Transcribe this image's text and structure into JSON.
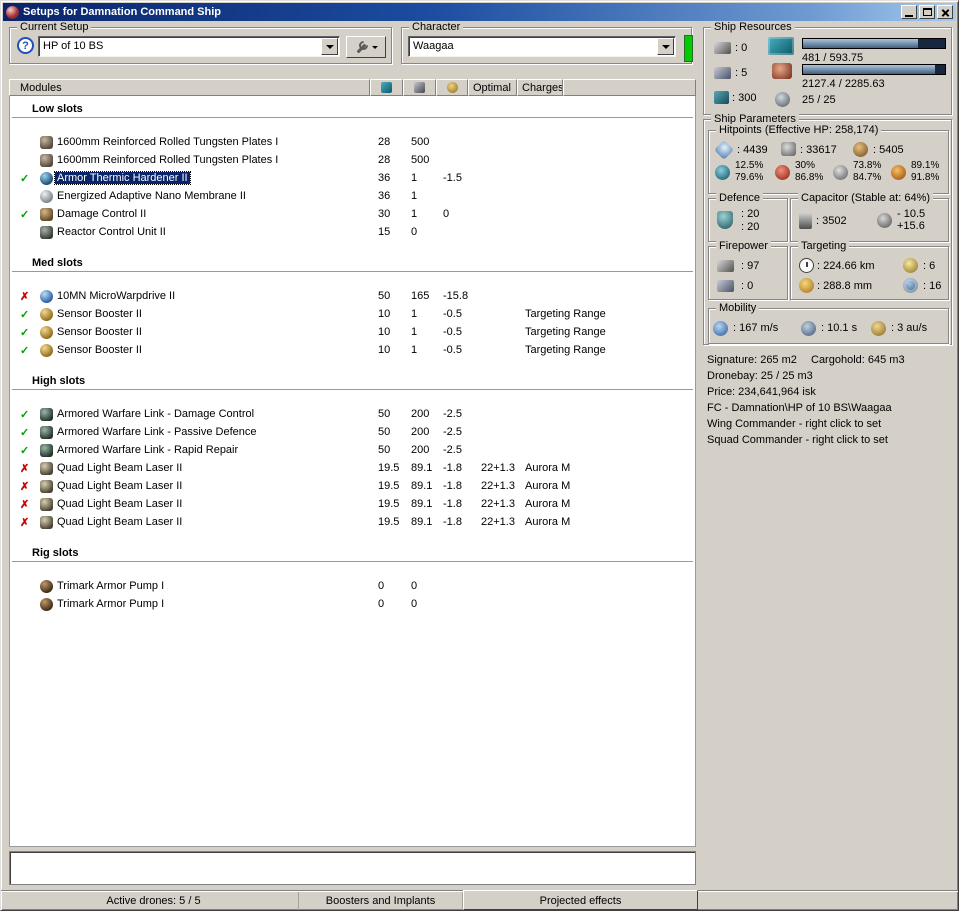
{
  "window": {
    "title": "Setups for Damnation Command Ship"
  },
  "colors": {
    "titlebar_left": "#0a246a",
    "titlebar_right": "#a6caf0",
    "selection": "#0a246a",
    "status_ok": "#00a000",
    "status_error": "#cc0000",
    "character_indicator": "#00cc00"
  },
  "status_glyphs": {
    "ok": "✓",
    "error": "✗"
  },
  "setup_bar": {
    "current_setup_label": "Current Setup",
    "help_glyph": "?",
    "setup_value": "HP of 10 BS",
    "character_label": "Character",
    "character_value": "Waagaa"
  },
  "modules_table": {
    "columns": {
      "modules": "Modules",
      "optimal": "Optimal",
      "charges": "Charges"
    },
    "sections": [
      {
        "title": "Low slots",
        "rows": [
          {
            "status": "none",
            "icon": "armor-plate",
            "name": "1600mm Reinforced Rolled Tungsten Plates I",
            "cpu": "28",
            "pg": "500",
            "cap": "",
            "optimal": "",
            "charges": "",
            "selected": false
          },
          {
            "status": "none",
            "icon": "armor-plate",
            "name": "1600mm Reinforced Rolled Tungsten Plates I",
            "cpu": "28",
            "pg": "500",
            "cap": "",
            "optimal": "",
            "charges": "",
            "selected": false
          },
          {
            "status": "ok",
            "icon": "armor-hardener",
            "name": "Armor Thermic Hardener II",
            "cpu": "36",
            "pg": "1",
            "cap": "-1.5",
            "optimal": "",
            "charges": "",
            "selected": true
          },
          {
            "status": "none",
            "icon": "nano-membrane",
            "name": "Energized Adaptive Nano Membrane II",
            "cpu": "36",
            "pg": "1",
            "cap": "",
            "optimal": "",
            "charges": "",
            "selected": false
          },
          {
            "status": "ok",
            "icon": "damage-control",
            "name": "Damage Control II",
            "cpu": "30",
            "pg": "1",
            "cap": "0",
            "optimal": "",
            "charges": "",
            "selected": false
          },
          {
            "status": "none",
            "icon": "reactor-control",
            "name": "Reactor Control Unit II",
            "cpu": "15",
            "pg": "0",
            "cap": "",
            "optimal": "",
            "charges": "",
            "selected": false
          }
        ]
      },
      {
        "title": "Med slots",
        "rows": [
          {
            "status": "error",
            "icon": "mwd",
            "name": "10MN MicroWarpdrive II",
            "cpu": "50",
            "pg": "165",
            "cap": "-15.8",
            "optimal": "",
            "charges": "",
            "selected": false
          },
          {
            "status": "ok",
            "icon": "sensor-booster",
            "name": "Sensor Booster II",
            "cpu": "10",
            "pg": "1",
            "cap": "-0.5",
            "optimal": "",
            "charges": "Targeting Range",
            "selected": false
          },
          {
            "status": "ok",
            "icon": "sensor-booster",
            "name": "Sensor Booster II",
            "cpu": "10",
            "pg": "1",
            "cap": "-0.5",
            "optimal": "",
            "charges": "Targeting Range",
            "selected": false
          },
          {
            "status": "ok",
            "icon": "sensor-booster",
            "name": "Sensor Booster II",
            "cpu": "10",
            "pg": "1",
            "cap": "-0.5",
            "optimal": "",
            "charges": "Targeting Range",
            "selected": false
          }
        ]
      },
      {
        "title": "High slots",
        "rows": [
          {
            "status": "ok",
            "icon": "warfare-link",
            "name": "Armored Warfare Link - Damage Control",
            "cpu": "50",
            "pg": "200",
            "cap": "-2.5",
            "optimal": "",
            "charges": "",
            "selected": false
          },
          {
            "status": "ok",
            "icon": "warfare-link",
            "name": "Armored Warfare Link - Passive Defence",
            "cpu": "50",
            "pg": "200",
            "cap": "-2.5",
            "optimal": "",
            "charges": "",
            "selected": false
          },
          {
            "status": "ok",
            "icon": "warfare-link",
            "name": "Armored Warfare Link - Rapid Repair",
            "cpu": "50",
            "pg": "200",
            "cap": "-2.5",
            "optimal": "",
            "charges": "",
            "selected": false
          },
          {
            "status": "error",
            "icon": "laser",
            "name": "Quad Light Beam Laser II",
            "cpu": "19.5",
            "pg": "89.1",
            "cap": "-1.8",
            "optimal": "22+1.3",
            "charges": "Aurora M",
            "selected": false
          },
          {
            "status": "error",
            "icon": "laser",
            "name": "Quad Light Beam Laser II",
            "cpu": "19.5",
            "pg": "89.1",
            "cap": "-1.8",
            "optimal": "22+1.3",
            "charges": "Aurora M",
            "selected": false
          },
          {
            "status": "error",
            "icon": "laser",
            "name": "Quad Light Beam Laser II",
            "cpu": "19.5",
            "pg": "89.1",
            "cap": "-1.8",
            "optimal": "22+1.3",
            "charges": "Aurora M",
            "selected": false
          },
          {
            "status": "error",
            "icon": "laser",
            "name": "Quad Light Beam Laser II",
            "cpu": "19.5",
            "pg": "89.1",
            "cap": "-1.8",
            "optimal": "22+1.3",
            "charges": "Aurora M",
            "selected": false
          }
        ]
      },
      {
        "title": "Rig slots",
        "rows": [
          {
            "status": "none",
            "icon": "rig",
            "name": "Trimark Armor Pump I",
            "cpu": "0",
            "pg": "0",
            "cap": "",
            "optimal": "",
            "charges": "",
            "selected": false
          },
          {
            "status": "none",
            "icon": "rig",
            "name": "Trimark Armor Pump I",
            "cpu": "0",
            "pg": "0",
            "cap": "",
            "optimal": "",
            "charges": "",
            "selected": false
          }
        ]
      }
    ]
  },
  "ship_resources": {
    "title": "Ship Resources",
    "turrets": ": 0",
    "launchers": ": 5",
    "calibration": ": 300",
    "cpu_text": "481 / 593.75",
    "cpu_pct": 81,
    "powergrid_text": "2127.4 / 2285.63",
    "powergrid_pct": 93,
    "drones_text": "25 / 25"
  },
  "ship_parameters": {
    "title": "Ship Parameters",
    "hitpoints": {
      "title": "Hitpoints (Effective HP: 258,174)",
      "shield": ": 4439",
      "armor": ": 33617",
      "hull": ": 5405",
      "resists": [
        {
          "type": "em",
          "shield": "12.5%",
          "armor": "79.6%"
        },
        {
          "type": "explosive",
          "shield": "30%",
          "armor": "86.8%"
        },
        {
          "type": "kinetic",
          "shield": "73.8%",
          "armor": "84.7%"
        },
        {
          "type": "thermal",
          "shield": "89.1%",
          "armor": "91.8%"
        }
      ]
    },
    "defence": {
      "title": "Defence",
      "value1": ": 20",
      "value2": ": 20"
    },
    "capacitor": {
      "title": "Capacitor (Stable at: 64%)",
      "amount": ": 3502",
      "delta_neg": "- 10.5",
      "delta_pos": "+15.6"
    },
    "firepower": {
      "title": "Firepower",
      "turret_dps": ": 97",
      "launcher_dps": ": 0"
    },
    "targeting": {
      "title": "Targeting",
      "range": ": 224.66 km",
      "max_targets": ": 6",
      "scan_res": ": 288.8 mm",
      "sensor_strength": ": 16"
    },
    "mobility": {
      "title": "Mobility",
      "speed": ": 167 m/s",
      "align_time": ": 10.1 s",
      "warp_speed": ": 3 au/s"
    }
  },
  "info": {
    "signature": "Signature: 265 m2",
    "cargohold": "Cargohold: 645 m3",
    "dronebay": "Dronebay: 25 / 25 m3",
    "price": "Price: 234,641,964 isk",
    "fc": "FC - Damnation\\HP of 10 BS\\Waagaa",
    "wing": "Wing Commander - right click to set",
    "squad": "Squad Commander - right click to set"
  },
  "bottom_tabs": [
    {
      "label": "Active drones: 5 / 5",
      "active": false
    },
    {
      "label": "Boosters and Implants",
      "active": false
    },
    {
      "label": "Projected effects",
      "active": true
    }
  ]
}
